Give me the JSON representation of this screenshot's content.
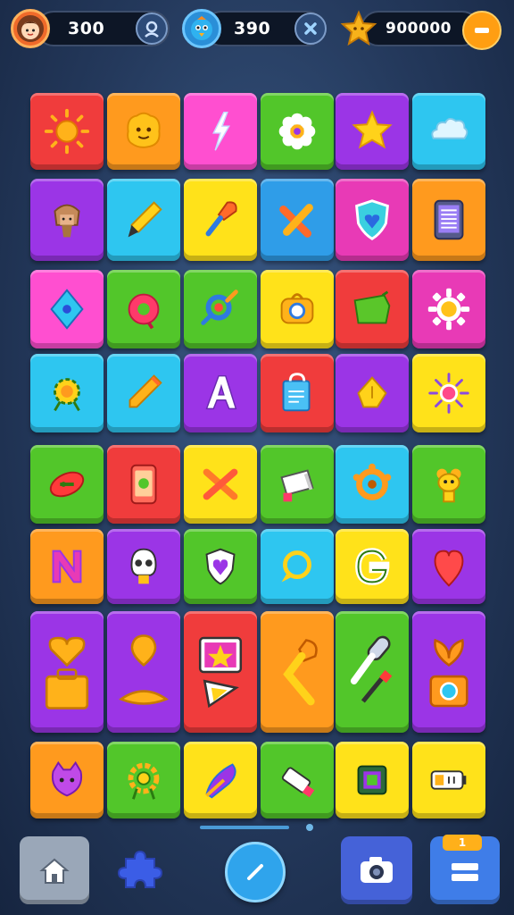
{
  "resources": {
    "player": {
      "icon": "avatar-girl-icon",
      "value": "300",
      "action_icon": "profile-icon"
    },
    "mascot": {
      "icon": "blue-bird-icon",
      "value": "390",
      "action_icon": "close-x-icon"
    },
    "stars": {
      "icon": "gold-star-icon",
      "value": "900000",
      "action_icon": "minus-icon"
    }
  },
  "colors": {
    "red": "#f03c3c",
    "orange": "#ff9a1e",
    "pink": "#ff4fd0",
    "green": "#52c62a",
    "purple": "#9b35e6",
    "cyan": "#2ec6f0",
    "yellow": "#ffe21a",
    "blue": "#2f9de8",
    "magenta": "#e83ab6"
  },
  "tiles": [
    {
      "icon": "sun-icon",
      "color": "red"
    },
    {
      "icon": "smiley-blob-icon",
      "color": "orange"
    },
    {
      "icon": "lightning-icon",
      "color": "pink"
    },
    {
      "icon": "flower-icon",
      "color": "green"
    },
    {
      "icon": "star-icon",
      "color": "purple"
    },
    {
      "icon": "cloud-icon",
      "color": "cyan"
    },
    {
      "icon": "pharaoh-head-icon",
      "color": "purple"
    },
    {
      "icon": "marker-pen-icon",
      "color": "cyan"
    },
    {
      "icon": "paint-brush-icon",
      "color": "yellow"
    },
    {
      "icon": "crossed-sticks-icon",
      "color": "blue"
    },
    {
      "icon": "shield-heart-icon",
      "color": "magenta"
    },
    {
      "icon": "tablet-icon",
      "color": "orange"
    },
    {
      "icon": "diamond-gem-icon",
      "color": "pink"
    },
    {
      "icon": "ring-badge-icon",
      "color": "green"
    },
    {
      "icon": "magnifier-icon",
      "color": "green"
    },
    {
      "icon": "camera-bag-icon",
      "color": "yellow"
    },
    {
      "icon": "green-folder-icon",
      "color": "red"
    },
    {
      "icon": "gear-icon",
      "color": "magenta"
    },
    {
      "icon": "sun-gear-icon",
      "color": "cyan"
    },
    {
      "icon": "pencil-icon",
      "color": "cyan"
    },
    {
      "icon": "letter-a-icon",
      "color": "purple"
    },
    {
      "icon": "shopping-bag-icon",
      "color": "red"
    },
    {
      "icon": "pen-nib-icon",
      "color": "purple"
    },
    {
      "icon": "sparkle-icon",
      "color": "yellow"
    },
    {
      "icon": "candy-icon",
      "color": "green"
    },
    {
      "icon": "phone-icon",
      "color": "red"
    },
    {
      "icon": "x-cross-icon",
      "color": "yellow"
    },
    {
      "icon": "stamp-icon",
      "color": "green"
    },
    {
      "icon": "cog-ring-icon",
      "color": "cyan"
    },
    {
      "icon": "robot-head-icon",
      "color": "green"
    },
    {
      "icon": "letter-n-icon",
      "color": "orange"
    },
    {
      "icon": "skull-icon",
      "color": "purple"
    },
    {
      "icon": "heart-shield-icon",
      "color": "green"
    },
    {
      "icon": "chat-bubble-icon",
      "color": "cyan"
    },
    {
      "icon": "letter-g-icon",
      "color": "yellow"
    },
    {
      "icon": "heart-pin-icon",
      "color": "purple"
    },
    {
      "icon": "heart-bag-icon",
      "color": "purple"
    },
    {
      "icon": "pin-croissant-icon",
      "color": "purple"
    },
    {
      "icon": "photo-frame-icon",
      "color": "red"
    },
    {
      "icon": "torch-icon",
      "color": "orange"
    },
    {
      "icon": "microphone-icon",
      "color": "green"
    },
    {
      "icon": "leaf-camera-icon",
      "color": "purple"
    },
    {
      "icon": "cat-face-icon",
      "color": "orange"
    },
    {
      "icon": "medal-icon",
      "color": "green"
    },
    {
      "icon": "feather-icon",
      "color": "yellow"
    },
    {
      "icon": "usb-stick-icon",
      "color": "green"
    },
    {
      "icon": "picture-icon",
      "color": "yellow"
    },
    {
      "icon": "battery-icon",
      "color": "yellow"
    }
  ],
  "nav": [
    {
      "icon": "home-icon"
    },
    {
      "icon": "puzzle-icon"
    },
    {
      "icon": "edit-pencil-icon"
    },
    {
      "icon": "camera-icon"
    },
    {
      "icon": "menu-icon",
      "badge": "1"
    }
  ]
}
